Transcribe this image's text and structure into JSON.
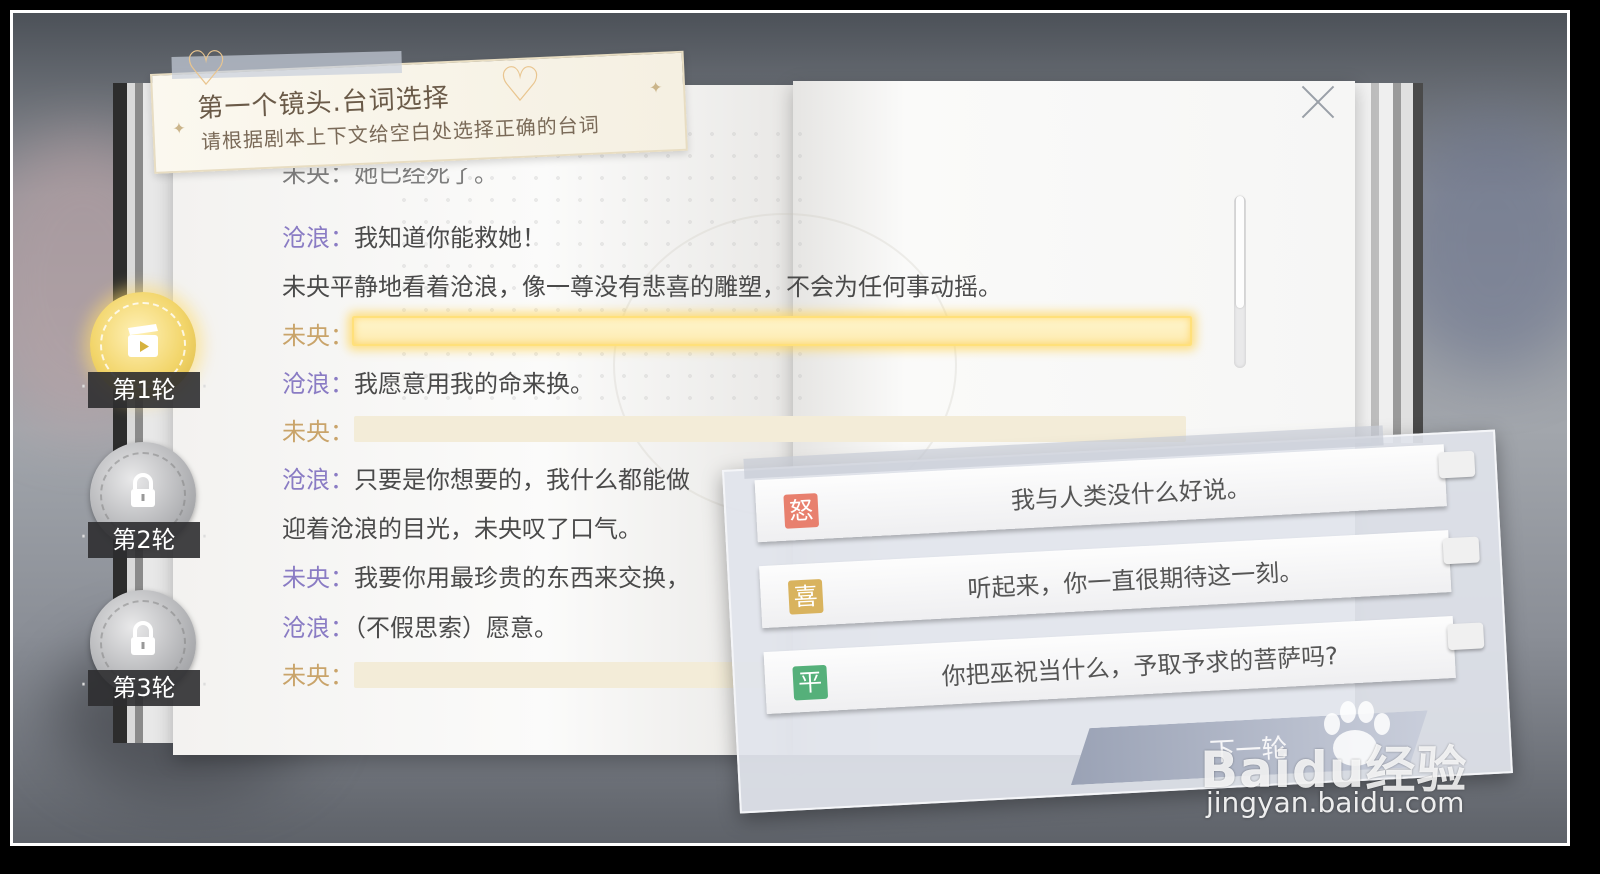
{
  "header": {
    "title": "第一个镜头.台词选择",
    "subtitle": "请根据剧本上下文给空白处选择正确的台词"
  },
  "script": {
    "cut_line": "未央：她已经死了。",
    "lines": [
      {
        "speaker": "沧浪：",
        "text": "我知道你能救她！"
      },
      {
        "speaker": "",
        "text": "未央平静地看着沧浪，像一尊没有悲喜的雕塑，不会为任何事动摇。"
      },
      {
        "speaker": "未央：",
        "text": ""
      },
      {
        "speaker": "沧浪：",
        "text": "我愿意用我的命来换。"
      },
      {
        "speaker": "未央：",
        "text": ""
      },
      {
        "speaker": "沧浪：",
        "text": "只要是你想要的，我什么都能做"
      },
      {
        "speaker": "",
        "text": "迎着沧浪的目光，未央叹了口气。"
      },
      {
        "speaker": "未央：",
        "text": "我要你用最珍贵的东西来交换，"
      },
      {
        "speaker": "沧浪：",
        "text": "（不假思索）愿意。"
      },
      {
        "speaker": "未央：",
        "text": ""
      }
    ]
  },
  "rounds": [
    {
      "label": "第1轮",
      "state": "active"
    },
    {
      "label": "第2轮",
      "state": "locked"
    },
    {
      "label": "第3轮",
      "state": "locked"
    }
  ],
  "options": [
    {
      "tag": "怒",
      "tag_color": "#e8806e",
      "text": "我与人类没什么好说。"
    },
    {
      "tag": "喜",
      "tag_color": "#d9b35e",
      "text": "听起来，你一直很期待这一刻。"
    },
    {
      "tag": "平",
      "tag_color": "#55b07a",
      "text": "你把巫祝当什么，予取予求的菩萨吗?"
    }
  ],
  "next_button": {
    "label": "下一轮"
  },
  "watermark": {
    "logo": "Baidu经验",
    "url": "jingyan.baidu.com"
  },
  "icons": {
    "close": "close-icon",
    "lock": "lock-icon",
    "clapper": "clapperboard-icon"
  }
}
